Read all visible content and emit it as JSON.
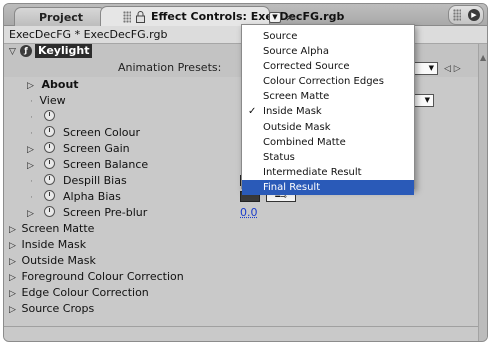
{
  "tabs": {
    "project": "Project",
    "effect_controls": "Effect Controls: ExecDecFG.rgb",
    "menu_arrow": "▼",
    "close": "×"
  },
  "header": {
    "title": "ExecDecFG * ExecDecFG.rgb"
  },
  "effect": {
    "name": "Keylight",
    "animation_presets_label": "Animation Presets:",
    "presets_value": "▼",
    "nav_arrows": "◁ ▷"
  },
  "properties": [
    {
      "label": "About",
      "kind": "group",
      "bold": true
    },
    {
      "label": "View",
      "kind": "select",
      "value": "▼"
    },
    {
      "label": "",
      "kind": "stopwatch-only"
    },
    {
      "label": "Screen Colour",
      "kind": "stopwatch"
    },
    {
      "label": "Screen Gain",
      "kind": "group-stopwatch"
    },
    {
      "label": "Screen Balance",
      "kind": "group-stopwatch"
    },
    {
      "label": "Despill Bias",
      "kind": "color"
    },
    {
      "label": "Alpha Bias",
      "kind": "color"
    },
    {
      "label": "Screen Pre-blur",
      "kind": "group-stopwatch",
      "value": "0.0"
    }
  ],
  "groups": [
    "Screen Matte",
    "Inside Mask",
    "Outside Mask",
    "Foreground Colour Correction",
    "Edge Colour Correction",
    "Source Crops"
  ],
  "dropdown": {
    "items": [
      {
        "label": "Source",
        "checked": false,
        "selected": false
      },
      {
        "label": "Source Alpha",
        "checked": false,
        "selected": false
      },
      {
        "label": "Corrected Source",
        "checked": false,
        "selected": false
      },
      {
        "label": "Colour Correction Edges",
        "checked": false,
        "selected": false
      },
      {
        "label": "Screen Matte",
        "checked": false,
        "selected": false
      },
      {
        "label": "Inside Mask",
        "checked": true,
        "selected": false
      },
      {
        "label": "Outside Mask",
        "checked": false,
        "selected": false
      },
      {
        "label": "Combined Matte",
        "checked": false,
        "selected": false
      },
      {
        "label": "Status",
        "checked": false,
        "selected": false
      },
      {
        "label": "Intermediate Result",
        "checked": false,
        "selected": false
      },
      {
        "label": "Final Result",
        "checked": false,
        "selected": true
      }
    ],
    "check_glyph": "✓"
  },
  "colors": {
    "selection": "#2a5ab8",
    "value_link": "#1a3ccc",
    "panel_bg": "#c9c9c9"
  }
}
